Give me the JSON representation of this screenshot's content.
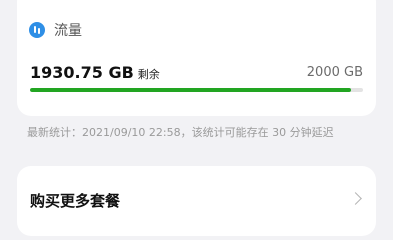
{
  "traffic_card": {
    "icon": "traffic-icon",
    "title": "流量",
    "remaining_value": "1930.75 GB",
    "remaining_label": "剩余",
    "total": "2000 GB",
    "remaining_fraction": 0.965,
    "bar_color": "#22a522",
    "icon_color": "#2f8fe6"
  },
  "stats_note": "最新统计：2021/09/10 22:58，该统计可能存在 30 分钟延迟",
  "more_plans": {
    "label": "购买更多套餐",
    "icon": "chevron-right-icon"
  }
}
